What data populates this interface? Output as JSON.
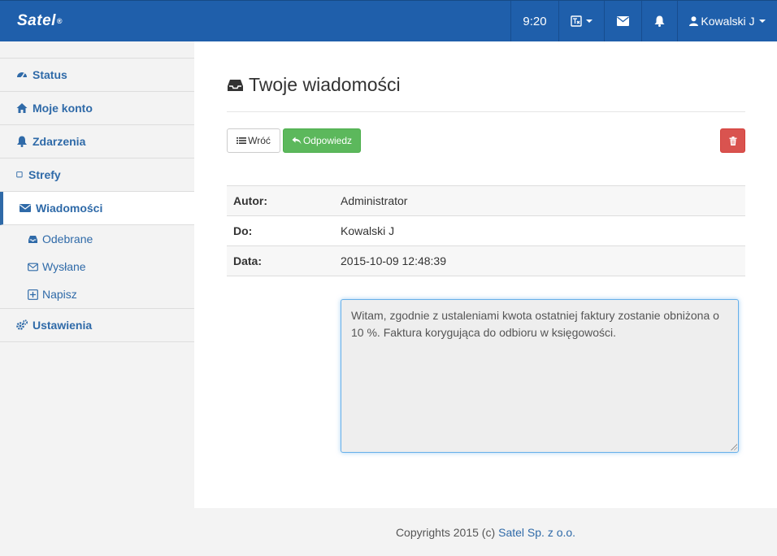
{
  "navbar": {
    "brand": "Satel",
    "brand_mark": "®",
    "time": "9:20",
    "user": "Kowalski J"
  },
  "sidebar": {
    "items": [
      {
        "label": "Status",
        "icon": "dashboard-icon"
      },
      {
        "label": "Moje konto",
        "icon": "home-icon"
      },
      {
        "label": "Zdarzenia",
        "icon": "bell-icon"
      },
      {
        "label": "Strefy",
        "icon": "square-icon"
      },
      {
        "label": "Wiadomości",
        "icon": "envelope-icon",
        "active": true
      },
      {
        "label": "Ustawienia",
        "icon": "gears-icon"
      }
    ],
    "sub_items": [
      {
        "label": "Odebrane",
        "icon": "inbox-icon"
      },
      {
        "label": "Wysłane",
        "icon": "envelope-outline-icon"
      },
      {
        "label": "Napisz",
        "icon": "plus-square-icon"
      }
    ]
  },
  "main": {
    "title": "Twoje wiadomości",
    "back_label": "Wróć",
    "reply_label": "Odpowiedz",
    "table": [
      {
        "label": "Autor:",
        "value": "Administrator"
      },
      {
        "label": "Do:",
        "value": "Kowalski J"
      },
      {
        "label": "Data:",
        "value": "2015-10-09 12:48:39"
      }
    ],
    "message": "Witam, zgodnie z ustaleniami kwota ostatniej faktury zostanie obniżona o 10 %. Faktura korygująca do odbioru w księgowości."
  },
  "footer": {
    "text": "Copyrights 2015 (c)",
    "link": "Satel Sp. z o.o."
  },
  "colors": {
    "navbar": "#1f5fab",
    "link": "#2f6aa8",
    "success": "#5cb85c",
    "danger": "#d9534f"
  }
}
